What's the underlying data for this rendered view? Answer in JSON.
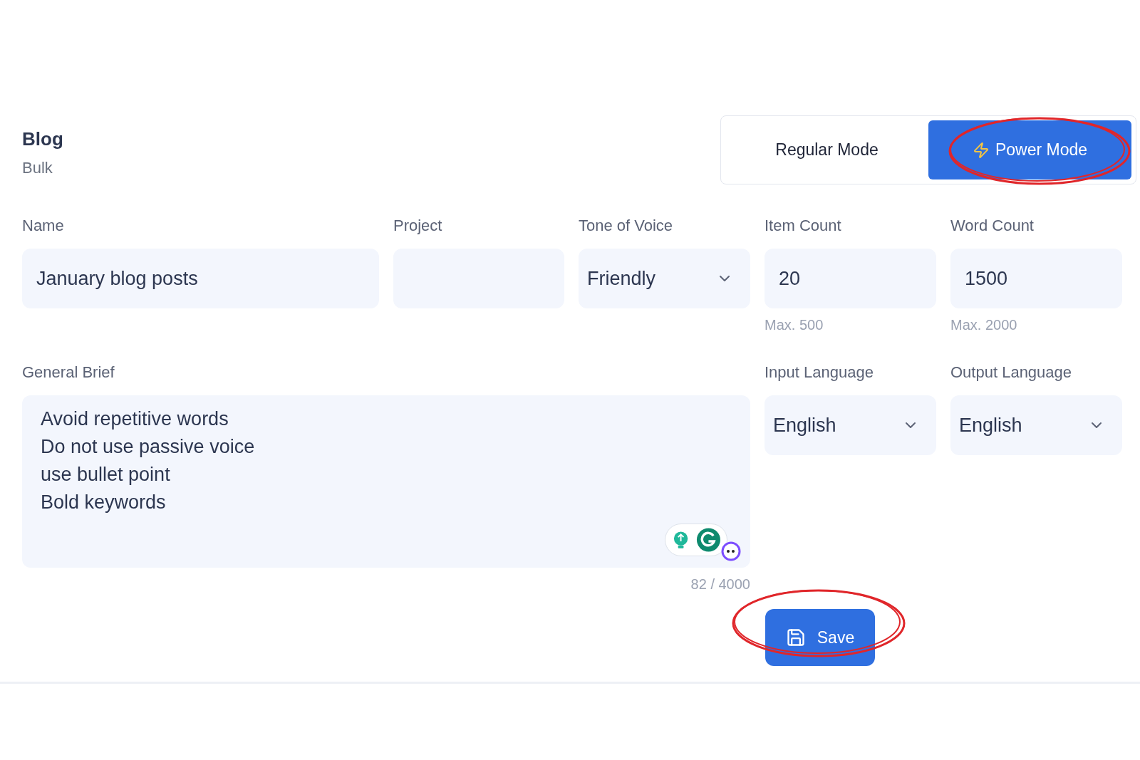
{
  "header": {
    "title": "Blog",
    "subtitle": "Bulk"
  },
  "modes": [
    {
      "label": "Regular Mode",
      "selected": false
    },
    {
      "label": "Power Mode",
      "selected": true
    }
  ],
  "fields": [
    {
      "kind": "text",
      "label": "Name",
      "value": "January blog posts"
    },
    {
      "kind": "text",
      "label": "Project"
    },
    {
      "kind": "select",
      "label": "Tone of Voice",
      "value": "Friendly"
    },
    {
      "kind": "text",
      "label": "Item Count",
      "value": "20",
      "hint": "Max. 500"
    },
    {
      "kind": "text",
      "label": "Word Count",
      "value": "1500",
      "hint": "Max. 2000"
    }
  ],
  "brief": {
    "label": "General Brief",
    "lines": [
      "Avoid repetitive words",
      "Do not use passive voice",
      "use bullet point",
      "Bold keywords"
    ],
    "counter": "82 / 4000"
  },
  "languages": [
    {
      "kind": "select",
      "label": "Input Language",
      "value": "English"
    },
    {
      "kind": "select",
      "label": "Output Language",
      "value": "English"
    }
  ],
  "save": {
    "label": "Save"
  }
}
